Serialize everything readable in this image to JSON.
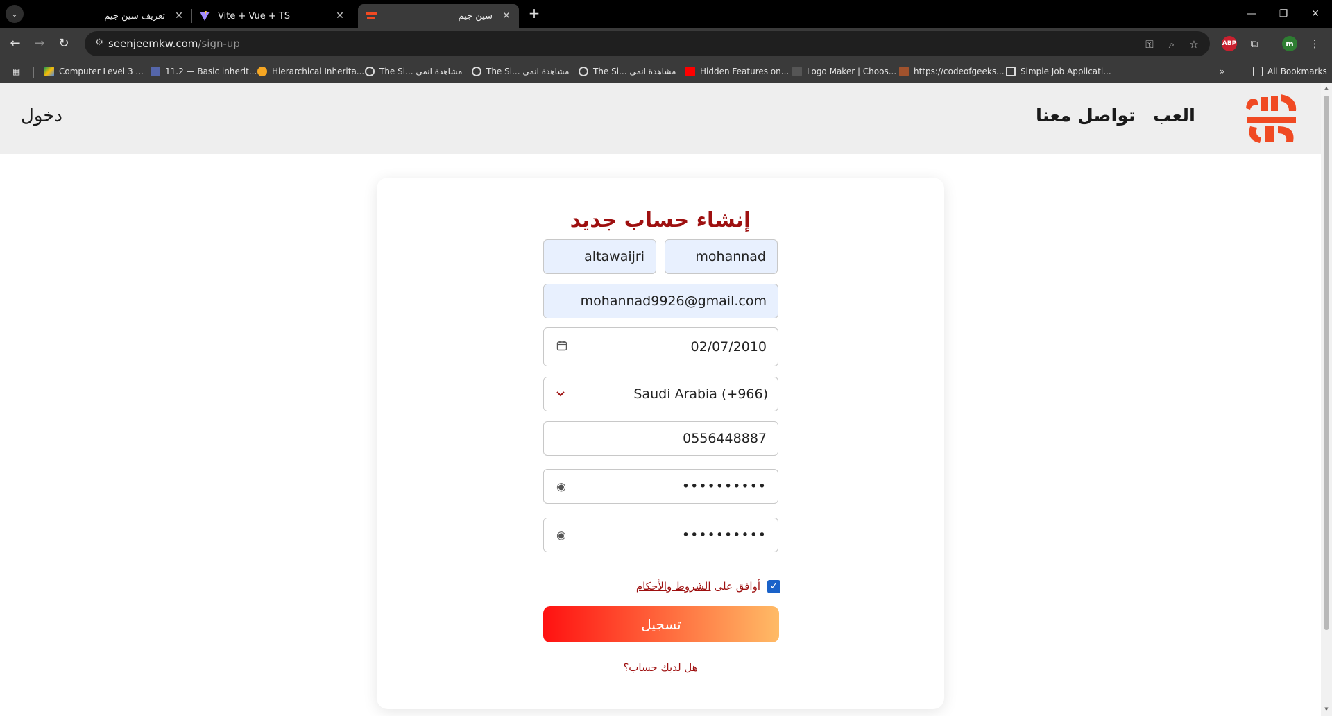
{
  "browser": {
    "tabs": [
      {
        "title": "تعريف سين جيم",
        "active": false
      },
      {
        "title": "Vite + Vue + TS",
        "active": false
      },
      {
        "title": "سين جيم",
        "active": true
      }
    ],
    "url_domain": "seenjeemkw.com",
    "url_path": "/sign-up",
    "profile_initial": "m",
    "extension_abp": "ABP",
    "bookmarks": [
      "Computer Level 3 ...",
      "11.2 — Basic inherit...",
      "Hierarchical Inherita...",
      "The Si... مشاهدة انمي",
      "The Si... مشاهدة انمي",
      "The Si... مشاهدة انمي",
      "Hidden Features on...",
      "Logo Maker | Choos...",
      "https://codeofgeeks...",
      "Simple Job Applicati..."
    ],
    "all_bookmarks": "All Bookmarks",
    "colors": {
      "chrome_bg": "#3a3a3a",
      "tabbar_bg": "#000000",
      "omnibox_bg": "#1f1f1f"
    }
  },
  "site": {
    "logo_text": "سين جيم",
    "nav": {
      "play": "العب",
      "contact": "تواصل معنا",
      "login": "دخول"
    },
    "colors": {
      "brand_red": "#9e1010",
      "logo_orange": "#f04a23",
      "header_bg": "#eeeeee"
    }
  },
  "form": {
    "title": "إنشاء حساب جديد",
    "first_name": "mohannad",
    "last_name": "altawaijri",
    "email": "mohannad9926@gmail.com",
    "birthdate": "02/07/2010",
    "country": "Saudi Arabia (+966)",
    "phone": "0556448887",
    "password_mask": "••••••••••",
    "confirm_mask": "••••••••••",
    "terms_prefix": "أوافق على",
    "terms_link": "الشروط والأحكام",
    "terms_checked": true,
    "submit_label": "تسجيل",
    "have_account": "هل لديك حساب؟"
  }
}
